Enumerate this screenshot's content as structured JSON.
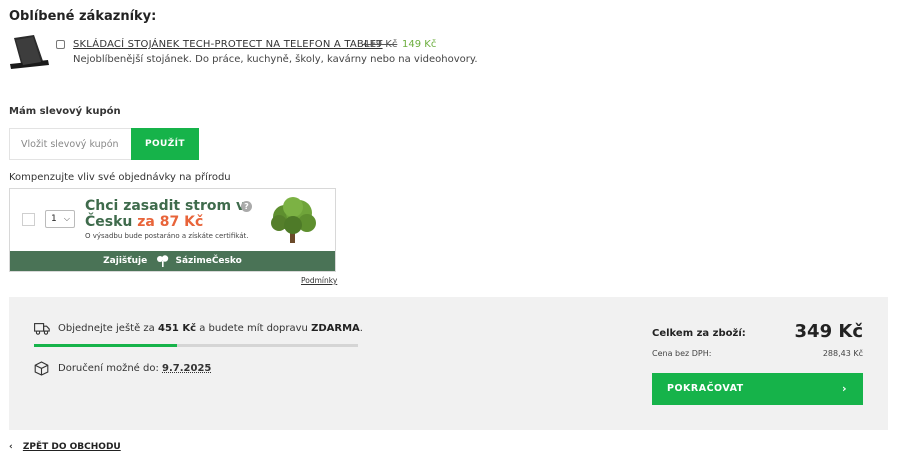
{
  "favorites": {
    "title": "Oblíbené zákazníky:",
    "product": {
      "name": "SKLÁDACÍ STOJÁNEK TECH-PROTECT NA TELEFON A TABLET",
      "old_price": "419 Kč",
      "new_price": "149 Kč",
      "description": "Nejoblíbenější stojánek. Do práce, kuchyně, školy, kavárny nebo na videohovory."
    }
  },
  "coupon": {
    "title": "Mám slevový kupón",
    "placeholder": "Vložit slevový kupón",
    "button": "POUŽÍT"
  },
  "compensation": {
    "title": "Kompenzujte vliv své objednávky na přírodu",
    "quantity": "1",
    "headline_1": "Chci zasadit strom v",
    "headline_2_prefix": "Česku",
    "headline_2_price": "za 87 Kč",
    "subtext": "O výsadbu bude postaráno a získáte certifikát.",
    "help": "?",
    "bar_prefix": "Zajišťuje",
    "bar_brand": "SázimeČesko",
    "conditions": "Podmínky"
  },
  "summary": {
    "shipping_pre": "Objednejte ještě za",
    "shipping_amount": "451 Kč",
    "shipping_mid": "a budete mít dopravu",
    "shipping_free": "ZDARMA",
    "shipping_end": ".",
    "progress_fraction": 0.44,
    "delivery_label": "Doručení možné do:",
    "delivery_date": "9.7.2025",
    "total_label": "Celkem za zboží:",
    "total_value": "349 Kč",
    "nodph_label": "Cena bez DPH:",
    "nodph_value": "288,43 Kč",
    "continue": "POKRAČOVAT",
    "continue_arrow": "›"
  },
  "back": {
    "arrow": "‹",
    "label": "ZPĚT DO OBCHODU"
  },
  "colors": {
    "accent_green": "#16b34a",
    "tree_green": "#4a7356",
    "tree_orange": "#e8643a",
    "sale_green": "#6cae3e"
  },
  "icons": [
    "stand-product-image",
    "tree-image",
    "help-icon",
    "truck-icon",
    "box-icon",
    "chevron-right-icon",
    "chevron-left-icon",
    "chevron-down-icon"
  ]
}
